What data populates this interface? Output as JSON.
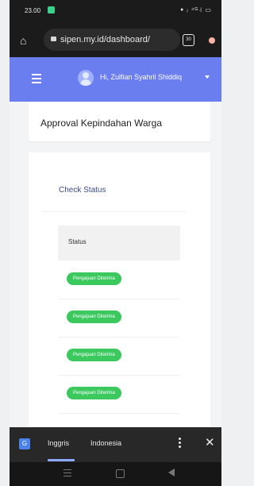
{
  "status_bar": {
    "time": "23.00",
    "icons": "ꔷ ᵢ ⁴ᴳ꜋ ▭"
  },
  "browser": {
    "url": "sipen.my.id/dashboard/",
    "tab_count": "30"
  },
  "header": {
    "greeting": "Hi, Zulfian Syahril Shiddiq"
  },
  "page": {
    "title": "Approval Kepindahan Warga",
    "check_status": "Check Status",
    "table": {
      "header": "Status",
      "rows": [
        {
          "status": "Pengajuan Diterima"
        },
        {
          "status": "Pengajuan Diterima"
        },
        {
          "status": "Pengajuan Diterima"
        },
        {
          "status": "Pengajuan Diterima"
        }
      ]
    }
  },
  "translate": {
    "active_language": "Inggris",
    "other_language": "Indonesia"
  },
  "colors": {
    "header": "#6a7ef0",
    "badge": "#3bc95e",
    "accent_text": "#3c4b8e"
  },
  "icons": [
    "home-icon",
    "lock-icon",
    "tab-switcher-icon",
    "menu-icon",
    "hamburger-icon",
    "avatar-icon",
    "caret-down-icon",
    "translate-icon",
    "more-vert-icon",
    "close-icon",
    "recent-apps-icon",
    "home-nav-icon",
    "back-icon"
  ]
}
